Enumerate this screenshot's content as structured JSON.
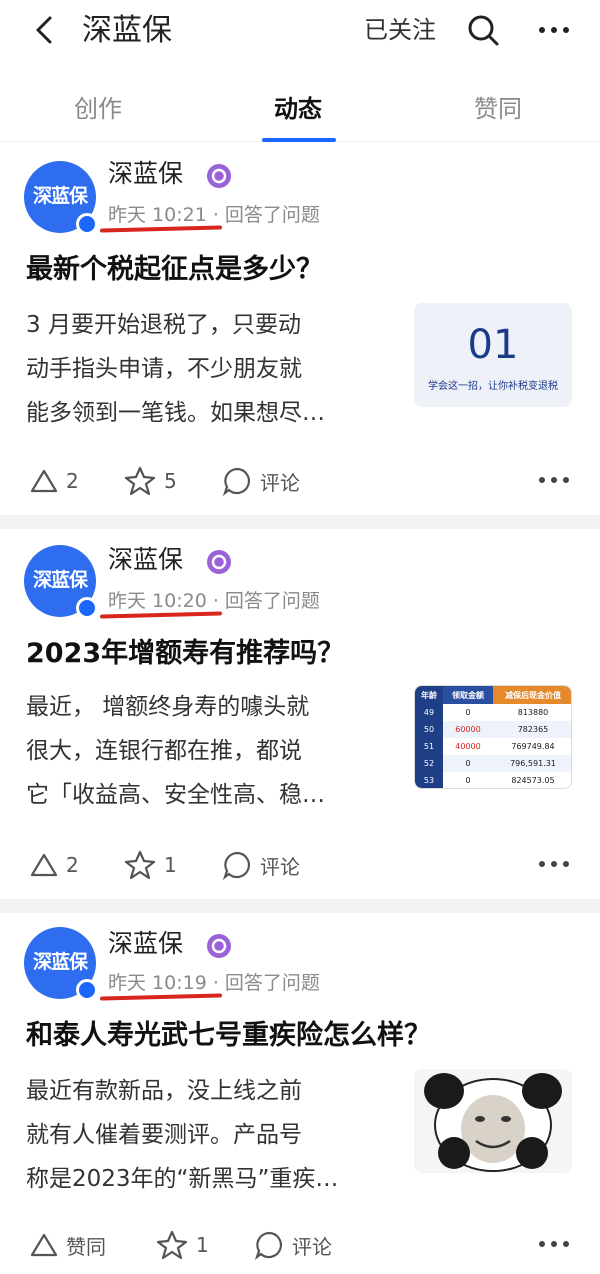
{
  "header": {
    "title": "深蓝保",
    "follow_label": "已关注"
  },
  "tabs": [
    {
      "label": "创作"
    },
    {
      "label": "动态"
    },
    {
      "label": "赞同"
    }
  ],
  "posts": [
    {
      "author": "深蓝保",
      "avatar_text": "深蓝保",
      "time": "昨天 10:21",
      "action": "· 回答了问题",
      "title": "最新个税起征点是多少？",
      "excerpt_lines": [
        "3 月要开始退税了，只要动",
        "动手指头申请，不少朋友就",
        "能多领到一笔钱。如果想尽…"
      ],
      "thumb": {
        "big": "01",
        "caption": "学会这一招，让你补税变退税"
      },
      "upvote": "2",
      "favorite": "5",
      "comment": "评论"
    },
    {
      "author": "深蓝保",
      "avatar_text": "深蓝保",
      "time": "昨天 10:20",
      "action": "· 回答了问题",
      "title": "2023年增额寿有推荐吗？",
      "excerpt_lines": [
        "最近， 增额终身寿的噱头就",
        "很大，连银行都在推，都说",
        "它「收益高、安全性高、稳…"
      ],
      "thumb": {
        "headers": [
          "年龄",
          "领取金额",
          "减保后现金价值"
        ],
        "rows": [
          [
            "49",
            "0",
            "813880"
          ],
          [
            "50",
            "60000",
            "782365"
          ],
          [
            "51",
            "40000",
            "769749.84"
          ],
          [
            "52",
            "0",
            "796,591.31"
          ],
          [
            "53",
            "0",
            "824573.05"
          ]
        ]
      },
      "upvote": "2",
      "favorite": "1",
      "comment": "评论"
    },
    {
      "author": "深蓝保",
      "avatar_text": "深蓝保",
      "time": "昨天 10:19",
      "action": "· 回答了问题",
      "title": "和泰人寿光武七号重疾险怎么样？",
      "excerpt_lines": [
        "最近有款新品，没上线之前",
        "就有人催着要测评。产品号",
        "称是2023年的“新黑马”重疾…"
      ],
      "thumb": {
        "kind": "panda-meme"
      },
      "upvote": "赞同",
      "favorite": "1",
      "comment": "评论"
    }
  ],
  "colors": {
    "accent": "#1a66ff",
    "annotation": "#d7261c",
    "avatar": "#2f6df0"
  }
}
